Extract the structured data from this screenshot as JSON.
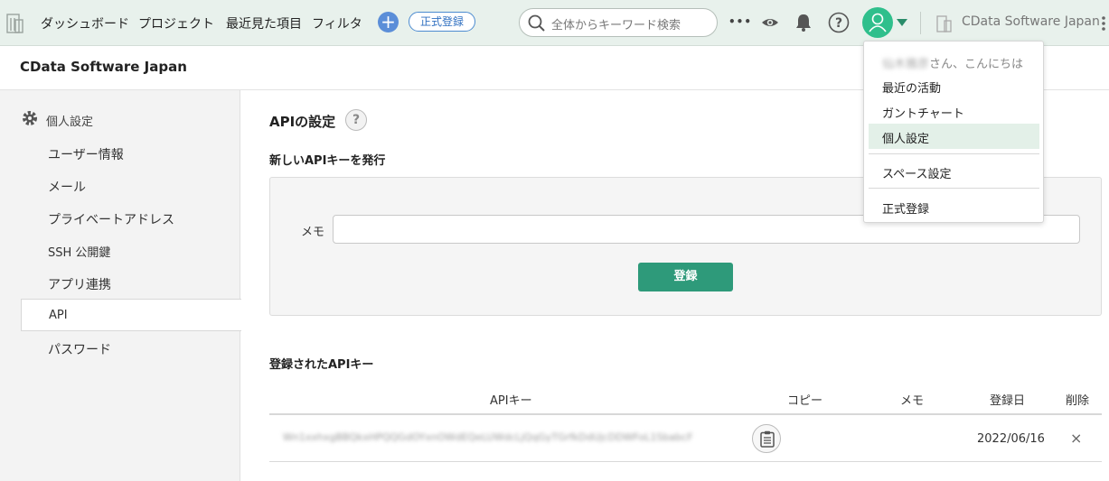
{
  "topbar": {
    "nav": [
      "ダッシュボード",
      "プロジェクト",
      "最近見た項目",
      "フィルタ"
    ],
    "plus_label": "+",
    "register_badge": "正式登録",
    "search_placeholder": "全体からキーワード検索",
    "more_label": "•••",
    "space_name": "CData Software Japan"
  },
  "space_header": {
    "title": "CData Software Japan"
  },
  "sidebar": {
    "section": "個人設定",
    "items": [
      "ユーザー情報",
      "メール",
      "プライベートアドレス",
      "SSH 公開鍵",
      "アプリ連携",
      "API",
      "パスワード"
    ],
    "active_index": 5
  },
  "main": {
    "title": "APIの設定",
    "help": "?",
    "new_key_heading": "新しいAPIキーを発行",
    "memo_label": "メモ",
    "memo_value": "",
    "submit_label": "登録",
    "registered_heading": "登録されたAPIキー",
    "columns": [
      "APIキー",
      "コピー",
      "メモ",
      "登録日",
      "削除"
    ],
    "rows": [
      {
        "api_key": "Wn1xxhxgBBQkxHPQQGdOYxnOWdEQeLUWdcLjQqGyTGrfkDdUjcDDWFoL1SbabcF",
        "memo": "",
        "date": "2022/06/16",
        "delete": "×"
      }
    ]
  },
  "dropdown": {
    "user_name": "仙木雅彦",
    "greeting_suffix": "さん、こんにちは",
    "items": [
      "最近の活動",
      "ガントチャート",
      "個人設定",
      "スペース設定",
      "正式登録"
    ],
    "active_index": 2
  },
  "colors": {
    "accent": "#2e9a7a",
    "topbar_bg": "#e8f1ec",
    "avatar": "#2fbf8c"
  }
}
